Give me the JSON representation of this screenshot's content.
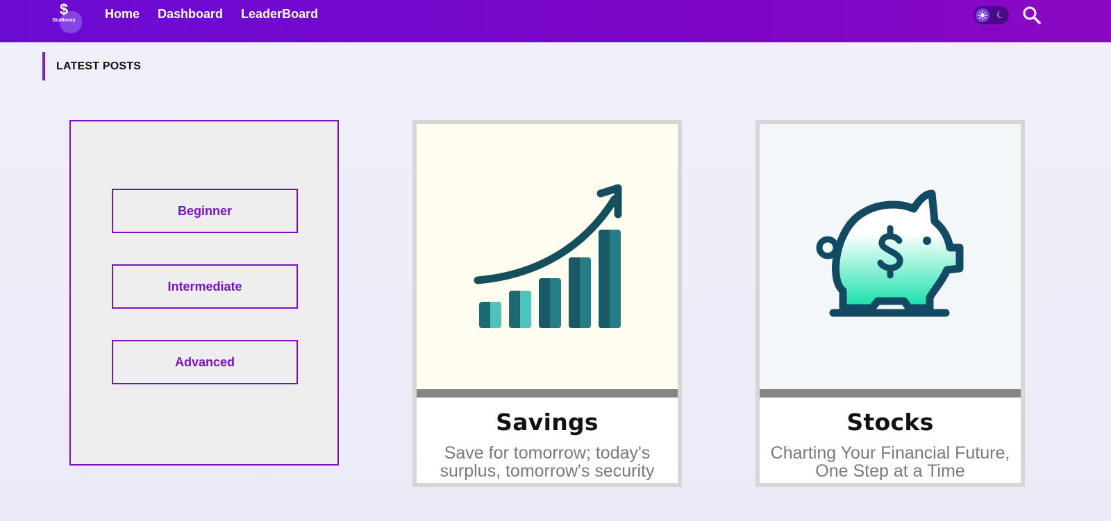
{
  "header": {
    "logo_symbol": "$",
    "logo_name": "StuMoney",
    "nav": [
      "Home",
      "Dashboard",
      "LeaderBoard"
    ],
    "theme_toggle_icons": [
      "sun-icon",
      "moon-icon"
    ],
    "search_icon": "search-icon",
    "colors": {
      "gradient_start": "#6a0bd4",
      "gradient_end": "#8a08c4"
    }
  },
  "section": {
    "title": "LATEST POSTS"
  },
  "levels": {
    "items": [
      "Beginner",
      "Intermediate",
      "Advanced"
    ],
    "accent": "#7a12c4"
  },
  "posts": [
    {
      "title": "Savings",
      "description": "Save for tomorrow; today's surplus, tomorrow's security",
      "icon": "growth-chart-icon"
    },
    {
      "title": "Stocks",
      "description": "Charting Your Financial Future, One Step at a Time",
      "icon": "piggy-bank-icon"
    }
  ]
}
